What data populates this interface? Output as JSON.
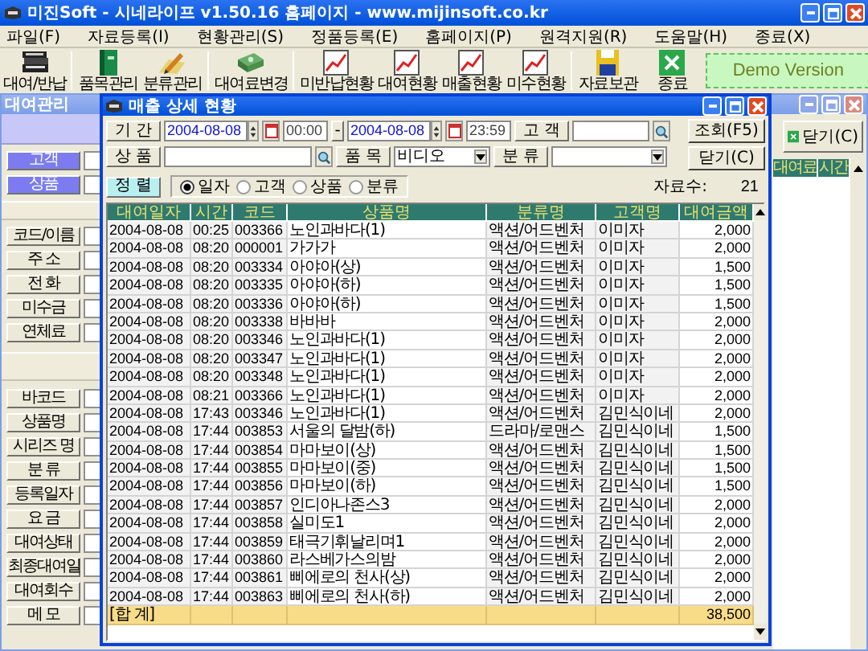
{
  "app": {
    "title": "미진Soft - 시네라이프 v1.50.16 홈페이지 - www.mijinsoft.co.kr",
    "menu": [
      "파일(F)",
      "자료등록(I)",
      "현황관리(S)",
      "정품등록(E)",
      "홈페이지(P)",
      "원격지원(R)",
      "도움말(H)",
      "종료(X)"
    ],
    "toolbar_groups": [
      [
        {
          "label": "대여/반납",
          "kind": "books"
        }
      ],
      [
        {
          "label": "품목관리",
          "kind": "book"
        },
        {
          "label": "분류관리",
          "kind": "pencil"
        }
      ],
      [
        {
          "label": "대여료변경",
          "kind": "money"
        }
      ],
      [
        {
          "label": "미반납현황",
          "kind": "chart"
        },
        {
          "label": "대여현황",
          "kind": "chart"
        },
        {
          "label": "매출현황",
          "kind": "chart"
        },
        {
          "label": "미수현황",
          "kind": "chart"
        }
      ],
      [
        {
          "label": "자료보관",
          "kind": "floppy"
        },
        {
          "label": "종료",
          "kind": "exit"
        }
      ]
    ],
    "demo_badge": "Demo Version"
  },
  "rental_window": {
    "title": "대여관리",
    "lookup_buttons": [
      "고객",
      "상품"
    ],
    "customer_fields": [
      "코드/이름",
      "주 소",
      "전 화",
      "미수금",
      "연체료"
    ],
    "product_fields": [
      "바코드",
      "상품명",
      "시리즈 명",
      "분 류",
      "등록일자",
      "요 금",
      "대여상태",
      "최종대여일",
      "대여회수",
      "메 모"
    ],
    "close_button": "닫기(C)",
    "table_columns": [
      "대여료",
      "시간"
    ]
  },
  "sales_dialog": {
    "title": "매출 상세 현황",
    "period_button": "기 간",
    "date_from": "2004-08-08",
    "time_from": "00:00",
    "range_button": "-",
    "date_to": "2004-08-08",
    "time_to": "23:59",
    "customer_button": "고 객",
    "search_button": "조회(F5)",
    "product_button": "상 품",
    "item_button": "품 목",
    "item_select": "비디오",
    "category_button": "분 류",
    "close_button": "닫기(C)",
    "sort_button": "정 렬",
    "sort_options": [
      {
        "label": "일자",
        "selected": true
      },
      {
        "label": "고객",
        "selected": false
      },
      {
        "label": "상품",
        "selected": false
      },
      {
        "label": "분류",
        "selected": false
      }
    ],
    "count_label": "자료수:",
    "count": "21",
    "columns": [
      "대여일자",
      "시간",
      "코드",
      "상품명",
      "분류명",
      "고객명",
      "대여금액"
    ],
    "rows": [
      [
        "2004-08-08",
        "00:25",
        "003366",
        "노인과바다(1)",
        "액션/어드벤처",
        "이미자",
        "2,000"
      ],
      [
        "2004-08-08",
        "08:20",
        "000001",
        "가가가",
        "액션/어드벤처",
        "이미자",
        "2,000"
      ],
      [
        "2004-08-08",
        "08:20",
        "003334",
        "아야아(상)",
        "액션/어드벤처",
        "이미자",
        "1,500"
      ],
      [
        "2004-08-08",
        "08:20",
        "003335",
        "아야아(하)",
        "액션/어드벤처",
        "이미자",
        "1,500"
      ],
      [
        "2004-08-08",
        "08:20",
        "003336",
        "아야아(하)",
        "액션/어드벤처",
        "이미자",
        "1,500"
      ],
      [
        "2004-08-08",
        "08:20",
        "003338",
        "바바바",
        "액션/어드벤처",
        "이미자",
        "2,000"
      ],
      [
        "2004-08-08",
        "08:20",
        "003346",
        "노인과바다(1)",
        "액션/어드벤처",
        "이미자",
        "2,000"
      ],
      [
        "2004-08-08",
        "08:20",
        "003347",
        "노인과바다(1)",
        "액션/어드벤처",
        "이미자",
        "2,000"
      ],
      [
        "2004-08-08",
        "08:20",
        "003348",
        "노인과바다(1)",
        "액션/어드벤처",
        "이미자",
        "2,000"
      ],
      [
        "2004-08-08",
        "08:21",
        "003366",
        "노인과바다(1)",
        "액션/어드벤처",
        "이미자",
        "2,000"
      ],
      [
        "2004-08-08",
        "17:43",
        "003346",
        "노인과바다(1)",
        "액션/어드벤처",
        "김민식이네",
        "2,000"
      ],
      [
        "2004-08-08",
        "17:44",
        "003853",
        "서울의 달밤(하)",
        "드라마/로맨스",
        "김민식이네",
        "1,500"
      ],
      [
        "2004-08-08",
        "17:44",
        "003854",
        "마마보이(상)",
        "액션/어드벤처",
        "김민식이네",
        "1,500"
      ],
      [
        "2004-08-08",
        "17:44",
        "003855",
        "마마보이(중)",
        "액션/어드벤처",
        "김민식이네",
        "1,500"
      ],
      [
        "2004-08-08",
        "17:44",
        "003856",
        "마마보이(하)",
        "액션/어드벤처",
        "김민식이네",
        "1,500"
      ],
      [
        "2004-08-08",
        "17:44",
        "003857",
        "인디아나존스3",
        "액션/어드벤처",
        "김민식이네",
        "2,000"
      ],
      [
        "2004-08-08",
        "17:44",
        "003858",
        "실미도1",
        "액션/어드벤처",
        "김민식이네",
        "2,000"
      ],
      [
        "2004-08-08",
        "17:44",
        "003859",
        "태극기휘날리며1",
        "액션/어드벤처",
        "김민식이네",
        "2,000"
      ],
      [
        "2004-08-08",
        "17:44",
        "003860",
        "라스베가스의밤",
        "액션/어드벤처",
        "김민식이네",
        "2,000"
      ],
      [
        "2004-08-08",
        "17:44",
        "003861",
        "삐에로의 천사(상)",
        "액션/어드벤처",
        "김민식이네",
        "2,000"
      ],
      [
        "2004-08-08",
        "17:44",
        "003863",
        "삐에로의 천사(하)",
        "액션/어드벤처",
        "김민식이네",
        "2,000"
      ]
    ],
    "total": {
      "label": "[합 계]",
      "amount": "38,500"
    }
  }
}
